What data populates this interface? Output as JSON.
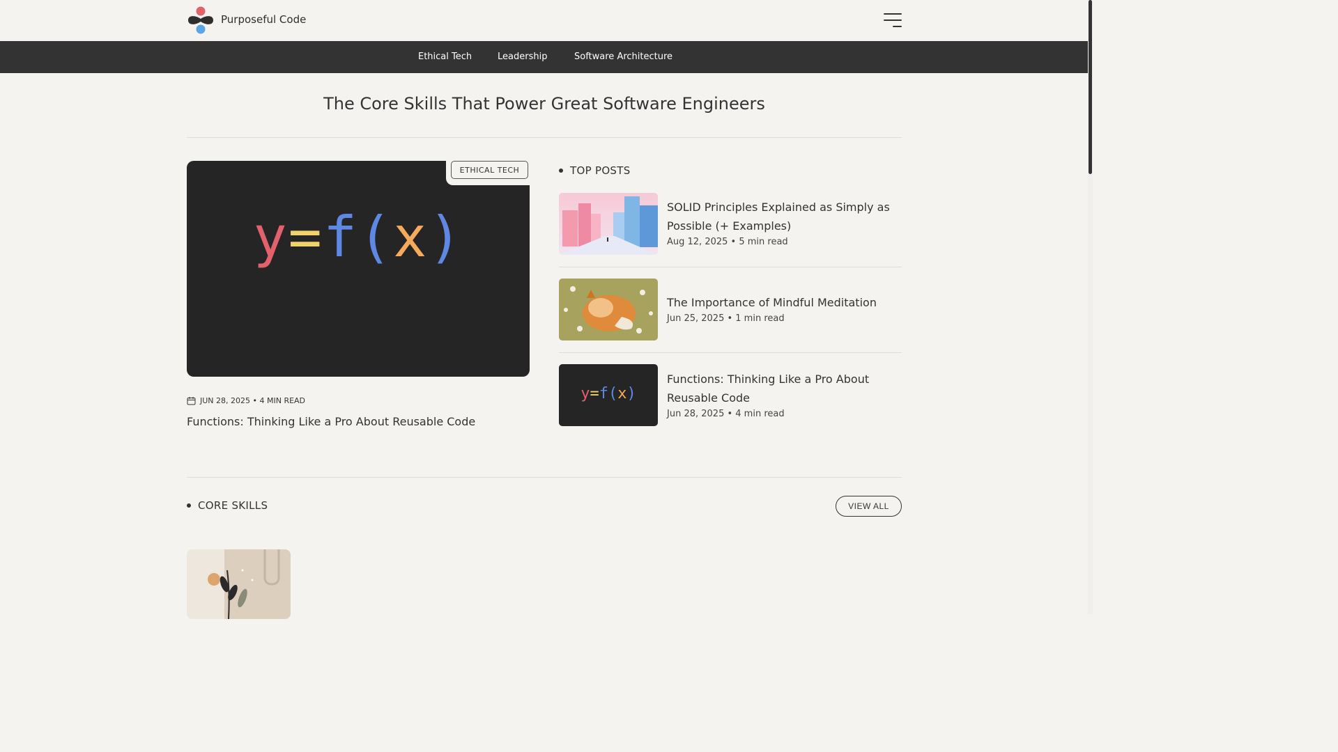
{
  "site": {
    "name": "Purposeful Code"
  },
  "nav": {
    "items": [
      "Ethical Tech",
      "Leadership",
      "Software Architecture"
    ]
  },
  "page": {
    "title": "The Core Skills That Power Great Software Engineers"
  },
  "featured": {
    "tag": "ETHICAL TECH",
    "formula": {
      "y": "y",
      "eq": "=",
      "f": "f",
      "open": "(",
      "x": "x",
      "close": ")"
    },
    "meta": "JUN 28, 2025 • 4 MIN READ",
    "title": "Functions: Thinking Like a Pro About Reusable Code"
  },
  "top_posts": {
    "label": "TOP POSTS",
    "items": [
      {
        "title": "SOLID Principles Explained as Simply as Possible (+ Examples)",
        "meta": "Aug 12, 2025 • 5 min read"
      },
      {
        "title": "The Importance of Mindful Meditation",
        "meta": "Jun 25, 2025 • 1 min read"
      },
      {
        "title": "Functions: Thinking Like a Pro About Reusable Code",
        "meta": "Jun 28, 2025 • 4 min read"
      }
    ]
  },
  "core_skills": {
    "label": "CORE SKILLS",
    "view_all": "VIEW ALL"
  },
  "colors": {
    "nav_bg": "#333333",
    "page_bg": "#f5f3ef",
    "hero_bg": "#252525",
    "logo_red": "#e3606d",
    "logo_blue": "#5aa5e6",
    "logo_dark": "#2e2e2e"
  }
}
